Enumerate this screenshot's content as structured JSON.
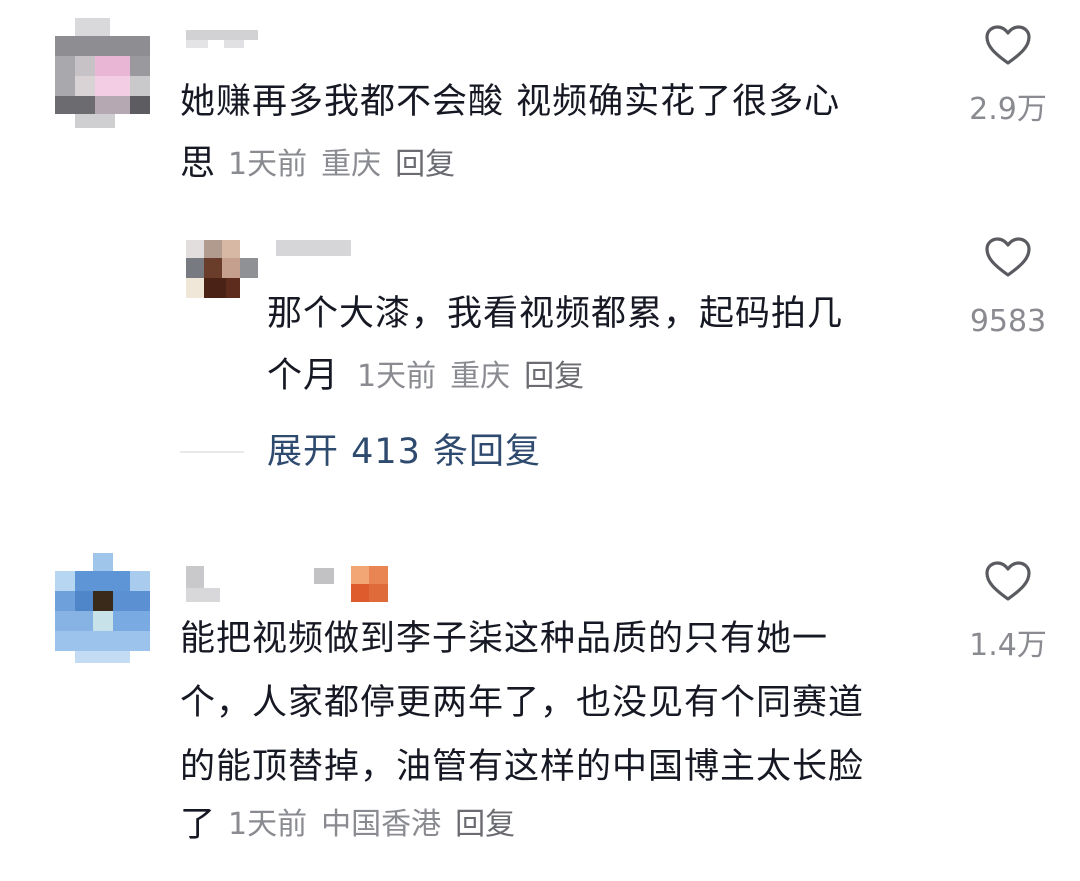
{
  "comments": [
    {
      "text_lines": [
        "她赚再多我都不会酸 视频确实花了很多心",
        "思"
      ],
      "time": "1天前",
      "location": "重庆",
      "reply_label": "回复",
      "likes": "2.9万",
      "replies": [
        {
          "text_lines": [
            "那个大漆，我看视频都累，起码拍几",
            "个月"
          ],
          "time": "1天前",
          "location": "重庆",
          "reply_label": "回复",
          "likes": "9583"
        }
      ],
      "expand_label": "展开 413 条回复"
    },
    {
      "text_lines": [
        "能把视频做到李子柒这种品质的只有她一",
        "个，人家都停更两年了，也没见有个同赛道",
        "的能顶替掉，油管有这样的中国博主太长脸",
        "了"
      ],
      "time": "1天前",
      "location": "中国香港",
      "reply_label": "回复",
      "likes": "1.4万"
    }
  ],
  "icons": {
    "like": "heart-outline-icon"
  },
  "colors": {
    "text": "#161823",
    "meta": "#8a8b91",
    "expand": "#2e4a6e",
    "icon": "#5a5b60"
  }
}
